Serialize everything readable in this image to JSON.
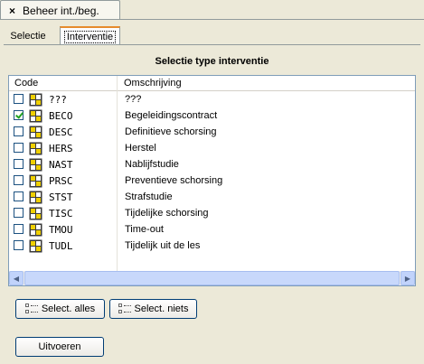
{
  "document_tab": {
    "close_glyph": "×",
    "title": "Beheer int./beg."
  },
  "tabs": [
    {
      "label": "Selectie",
      "active": false
    },
    {
      "label": "Interventie",
      "active": true
    }
  ],
  "section_title": "Selectie type interventie",
  "list": {
    "columns": {
      "code": "Code",
      "description": "Omschrijving"
    },
    "rows": [
      {
        "checked": false,
        "code": "???",
        "description": "???"
      },
      {
        "checked": true,
        "code": "BECO",
        "description": "Begeleidingscontract"
      },
      {
        "checked": false,
        "code": "DESC",
        "description": "Definitieve schorsing"
      },
      {
        "checked": false,
        "code": "HERS",
        "description": "Herstel"
      },
      {
        "checked": false,
        "code": "NAST",
        "description": "Nablijfstudie"
      },
      {
        "checked": false,
        "code": "PRSC",
        "description": "Preventieve schorsing"
      },
      {
        "checked": false,
        "code": "STST",
        "description": "Strafstudie"
      },
      {
        "checked": false,
        "code": "TISC",
        "description": "Tijdelijke schorsing"
      },
      {
        "checked": false,
        "code": "TMOU",
        "description": "Time-out"
      },
      {
        "checked": false,
        "code": "TUDL",
        "description": "Tijdelijk uit de les"
      }
    ],
    "scroll_left_glyph": "◀",
    "scroll_right_glyph": "▶"
  },
  "buttons": {
    "select_all": "Select. alles",
    "select_none": "Select. niets",
    "run": "Uitvoeren"
  },
  "colors": {
    "background": "#ece9d8",
    "list_border": "#7f9db9",
    "check_mark": "#21a121",
    "type_icon_yellow": "#f0d000",
    "active_tab_highlight": "#e68b2c",
    "scrollbar": "#c1d3fb"
  },
  "icons": {
    "row_type": "grid-type-icon",
    "select_all": "select-all-icon",
    "select_none": "select-none-icon"
  }
}
